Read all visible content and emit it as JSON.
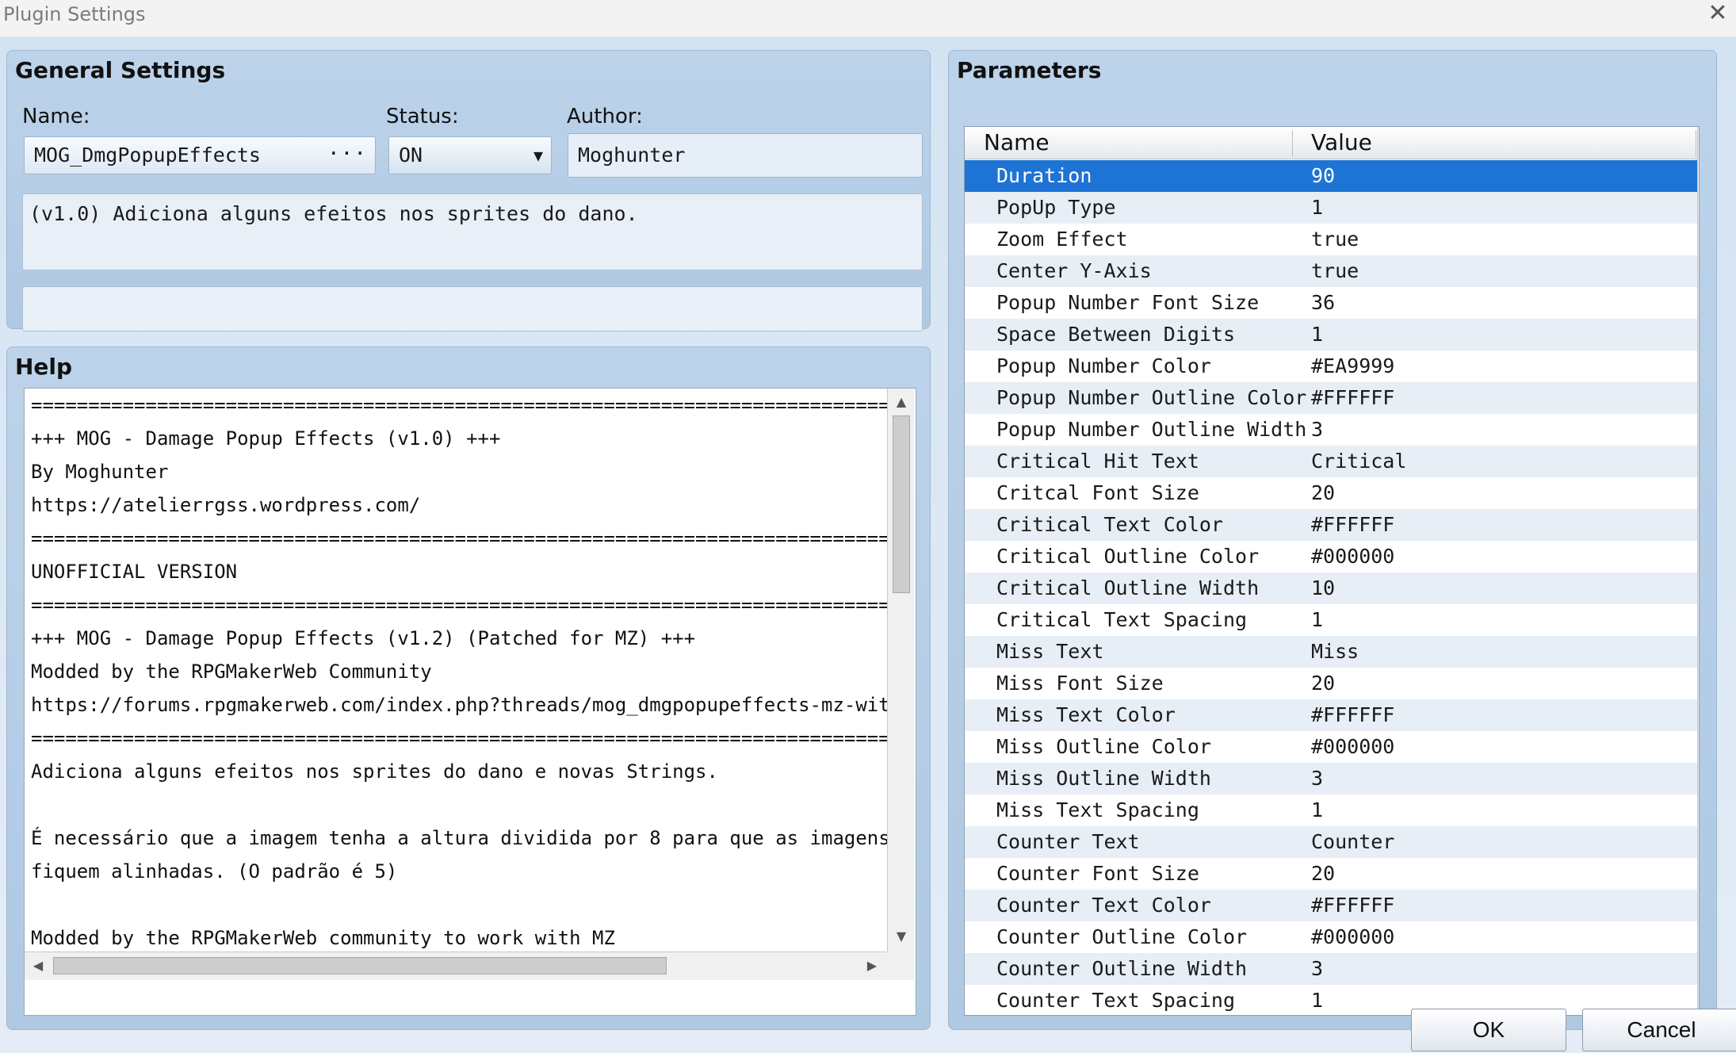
{
  "window": {
    "title": "Plugin Settings",
    "close_glyph": "✕"
  },
  "general": {
    "title": "General Settings",
    "name_label": "Name:",
    "name_value": "MOG_DmgPopupEffects",
    "name_button": "···",
    "status_label": "Status:",
    "status_value": "ON",
    "status_arrow": "▼",
    "author_label": "Author:",
    "author_value": "Moghunter",
    "description": "(v1.0) Adiciona alguns efeitos nos sprites do dano.",
    "extra": ""
  },
  "help": {
    "title": "Help",
    "text": "================================================================================\n+++ MOG - Damage Popup Effects (v1.0) +++\nBy Moghunter\nhttps://atelierrgss.wordpress.com/\n================================================================================\nUNOFFICIAL VERSION\n================================================================================\n+++ MOG - Damage Popup Effects (v1.2) (Patched for MZ) +++\nModded by the RPGMakerWeb Community\nhttps://forums.rpgmakerweb.com/index.php?threads/mog_dmgpopupeffects-mz-with-\n================================================================================\nAdiciona alguns efeitos nos sprites do dano e novas Strings.\n\nÉ necessário que a imagem tenha a altura dividida por 8 para que as imagens\nfiquem alinhadas. (O padrão é 5)\n\nModded by the RPGMakerWeb community to work with MZ"
  },
  "params": {
    "title": "Parameters",
    "col_name": "Name",
    "col_value": "Value",
    "rows": [
      {
        "name": "Duration",
        "value": "90"
      },
      {
        "name": "PopUp Type",
        "value": "1"
      },
      {
        "name": "Zoom Effect",
        "value": "true"
      },
      {
        "name": "Center Y-Axis",
        "value": "true"
      },
      {
        "name": "Popup Number Font Size",
        "value": "36"
      },
      {
        "name": "Space Between Digits",
        "value": "1"
      },
      {
        "name": "Popup Number Color",
        "value": "#EA9999"
      },
      {
        "name": "Popup Number Outline Color",
        "value": "#FFFFFF"
      },
      {
        "name": "Popup Number Outline Width",
        "value": "3"
      },
      {
        "name": "Critical Hit Text",
        "value": "Critical"
      },
      {
        "name": "Critcal Font Size",
        "value": "20"
      },
      {
        "name": "Critical Text Color",
        "value": "#FFFFFF"
      },
      {
        "name": "Critical Outline Color",
        "value": "#000000"
      },
      {
        "name": "Critical Outline Width",
        "value": "10"
      },
      {
        "name": "Critical Text Spacing",
        "value": "1"
      },
      {
        "name": "Miss Text",
        "value": "Miss"
      },
      {
        "name": "Miss Font Size",
        "value": "20"
      },
      {
        "name": "Miss Text Color",
        "value": "#FFFFFF"
      },
      {
        "name": "Miss Outline Color",
        "value": "#000000"
      },
      {
        "name": "Miss Outline Width",
        "value": "3"
      },
      {
        "name": "Miss Text Spacing",
        "value": "1"
      },
      {
        "name": "Counter Text",
        "value": "Counter"
      },
      {
        "name": "Counter Font Size",
        "value": "20"
      },
      {
        "name": "Counter Text Color",
        "value": "#FFFFFF"
      },
      {
        "name": "Counter Outline Color",
        "value": "#000000"
      },
      {
        "name": "Counter Outline Width",
        "value": "3"
      },
      {
        "name": "Counter Text Spacing",
        "value": "1"
      }
    ]
  },
  "scroll_icons": {
    "up": "▲",
    "down": "▼",
    "left": "◀",
    "right": "▶"
  },
  "buttons": {
    "ok": "OK",
    "cancel": "Cancel"
  },
  "colors": {
    "selection": "#1e74d4",
    "group_bg": "#b6cee6"
  }
}
